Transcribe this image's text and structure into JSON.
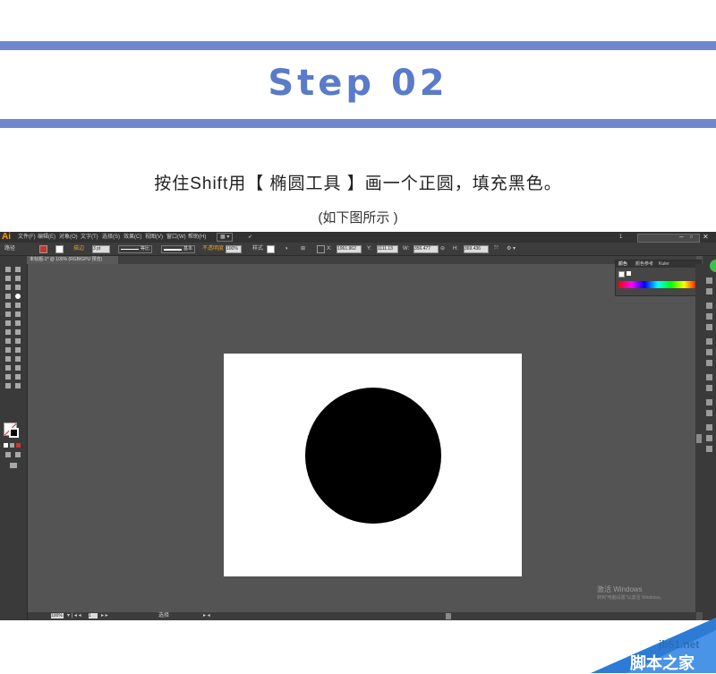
{
  "banner": {
    "title": "Step 02",
    "accent_color": "#7087cf"
  },
  "instruction": {
    "main": "按住Shift用【 椭圆工具 】画一个正圆，填充黑色。",
    "sub": "(如下图所示 )"
  },
  "app": {
    "logo": "Ai",
    "menu": [
      "文件(F)",
      "编辑(E)",
      "对象(O)",
      "文字(T)",
      "选择(S)",
      "效果(C)",
      "视图(V)",
      "窗口(W)",
      "帮助(H)"
    ],
    "workspace": "1",
    "window_controls": [
      "–",
      "▫",
      "✕"
    ],
    "control_bar": {
      "path_label": "路径",
      "stroke_label": "描边",
      "stroke_value": "3 pt",
      "stroke_style": "等比",
      "brush": "基本",
      "opacity_label": "不透明度",
      "opacity": "100%",
      "style_label": "样式",
      "x": "1961.962",
      "y": "1111.13",
      "w": "356.477",
      "h": "369.436"
    },
    "document_tab": "未标题-1* @ 100% (RGB/GPU 预览)",
    "color_panel": {
      "tabs": [
        "颜色",
        "颜色参考",
        "Kuler"
      ]
    },
    "status": {
      "zoom": "100%",
      "page": "1",
      "tool": "选择"
    },
    "canvas": {
      "artboard_color": "#ffffff",
      "shape": "circle",
      "shape_fill": "#000000"
    },
    "windows_watermark": {
      "line1": "激活 Windows",
      "line2": "转到\"电脑设置\"以激活 Windows。"
    }
  },
  "site_watermark": {
    "domain": "jb51.net",
    "name": "脚本之家"
  }
}
